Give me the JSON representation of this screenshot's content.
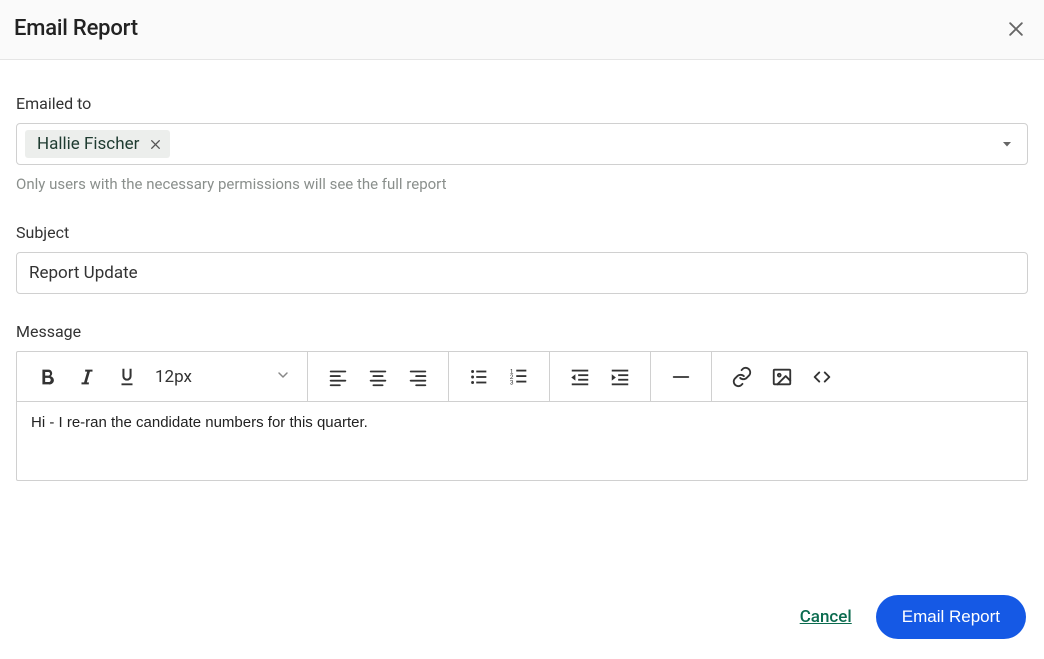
{
  "header": {
    "title": "Email Report"
  },
  "emailed_to": {
    "label": "Emailed to",
    "recipients": [
      {
        "name": "Hallie Fischer"
      }
    ],
    "helper": "Only users with the necessary permissions will see the full report"
  },
  "subject": {
    "label": "Subject",
    "value": "Report Update"
  },
  "message": {
    "label": "Message",
    "font_size": "12px",
    "body": "Hi - I re-ran the candidate numbers for this quarter."
  },
  "footer": {
    "cancel": "Cancel",
    "submit": "Email Report"
  }
}
